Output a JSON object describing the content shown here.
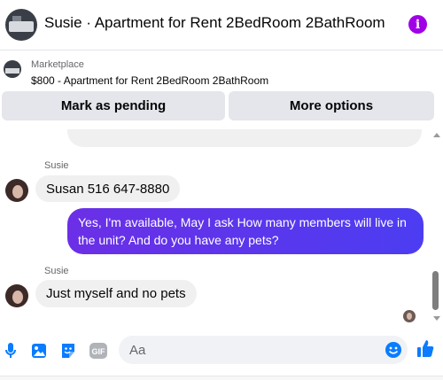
{
  "header": {
    "title": "Susie · Apartment for Rent 2BedRoom 2BathRoom",
    "info_icon": "info-icon",
    "info_glyph": "i",
    "avatar_icon": "apartment-photo"
  },
  "marketplace": {
    "label": "Marketplace",
    "listing": "$800 - Apartment for Rent 2BedRoom 2BathRoom",
    "buttons": {
      "pending": "Mark as pending",
      "more": "More options"
    }
  },
  "messages": [
    {
      "sender": "Susie",
      "text": "Susan 516 647-8880",
      "direction": "incoming"
    },
    {
      "text": "Yes, I'm available, May I ask How many members will live in the unit? And do you have any pets?",
      "direction": "outgoing"
    },
    {
      "sender": "Susie",
      "text": "Just myself and no pets",
      "direction": "incoming"
    }
  ],
  "composer": {
    "placeholder": "Aa",
    "gif_label": "GIF",
    "icons": [
      "microphone-icon",
      "photo-icon",
      "sticker-icon",
      "gif-icon",
      "emoji-icon",
      "thumbs-up-icon"
    ]
  },
  "colors": {
    "accent": "#0a7cff",
    "outgoing_bubble": "#5b36ec",
    "incoming_bubble": "#f0f0f0",
    "info": "#a000e6"
  }
}
